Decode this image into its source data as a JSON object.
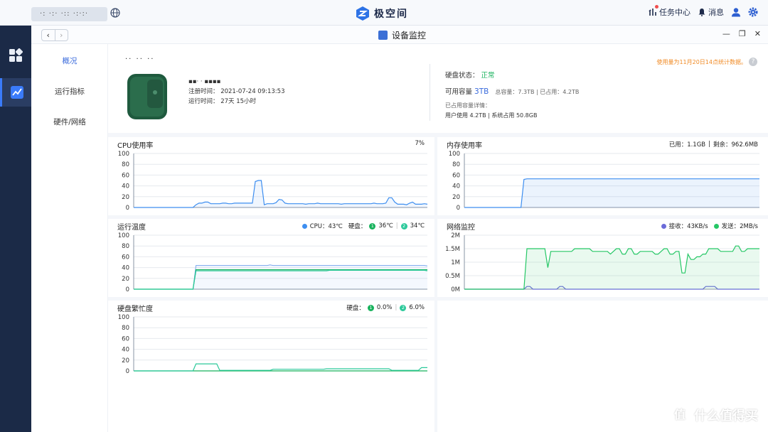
{
  "topbar": {
    "device_label": "·: ·:· ·:: ·:·:·",
    "brand": "极空间",
    "task_center": "任务中心",
    "messages": "消息"
  },
  "window": {
    "title": "设备监控",
    "nav_back": "‹",
    "nav_forward": "›"
  },
  "sidenav": {
    "items": [
      {
        "label": "概况"
      },
      {
        "label": "运行指标"
      },
      {
        "label": "硬件/网络"
      }
    ],
    "active_index": 0
  },
  "device": {
    "name": "·· ·· ··",
    "model_line": "▪▪·    ·    ▪▪▪▪",
    "reg_time": "注册时间： 2021-07-24 09:13:53",
    "uptime": "运行时间： 27天 15小时"
  },
  "storage": {
    "status_label": "硬盘状态：",
    "status_value": "正常",
    "available_label": "可用容量",
    "available_value": "3TB",
    "total": "总容量：7.3TB",
    "used": "已占用：4.2TB",
    "detail_label": "已占用容量详情：",
    "user_used": "用户使用 4.2TB",
    "system_used": "系统占用 50.8GB"
  },
  "notice": "使用量为11月20日14点统计数据。",
  "help_icon": "?",
  "charts": {
    "cpu": {
      "title": "CPU使用率",
      "value": "7%"
    },
    "memory": {
      "title": "内存使用率",
      "used": "已用：1.1GB",
      "remaining": "剩余：962.6MB"
    },
    "temperature": {
      "title": "运行温度",
      "cpu": "CPU：43℃",
      "disk_label": "硬盘：",
      "disk1_num": "1",
      "disk1": "36℃",
      "disk2_num": "2",
      "disk2": "34℃"
    },
    "network": {
      "title": "网络监控",
      "rx": "接收：43KB/s",
      "tx": "发送：2MB/s"
    },
    "disk_busy": {
      "title": "硬盘繁忙度",
      "disk_label": "硬盘：",
      "disk1_num": "1",
      "disk1": "0.0%",
      "disk2_num": "2",
      "disk2": "6.0%"
    }
  },
  "watermark": {
    "text": "什么值得买",
    "logo": "值"
  },
  "colors": {
    "accent": "#3a6bdc",
    "cpu": "#3d8ef0",
    "green": "#17b25c",
    "rx": "#6b6bd9",
    "tx": "#26c766",
    "orange": "#f08a24"
  },
  "chart_data": [
    {
      "type": "line",
      "title": "CPU使用率",
      "ylim": [
        0,
        100
      ],
      "yticks": [
        "100",
        "80",
        "60",
        "40",
        "20",
        "0"
      ],
      "series": [
        {
          "values": [
            0,
            0,
            0,
            0,
            0,
            0,
            0,
            0,
            0,
            0,
            0,
            0,
            0,
            0,
            0,
            0,
            0,
            0,
            0,
            0,
            0,
            5,
            8,
            8,
            10,
            10,
            7,
            7,
            7,
            7,
            8,
            8,
            7,
            7,
            8,
            8,
            8,
            8,
            8,
            8,
            8,
            48,
            50,
            50,
            5,
            7,
            7,
            7,
            9,
            15,
            14,
            8,
            7,
            7,
            7,
            7,
            7,
            7,
            6,
            7,
            7,
            7,
            8,
            7,
            7,
            7,
            7,
            7,
            7,
            7,
            6,
            7,
            7,
            7,
            7,
            7,
            7,
            7,
            7,
            7,
            7,
            8,
            7,
            7,
            7,
            8,
            18,
            18,
            10,
            6,
            6,
            6,
            5,
            8,
            10,
            6,
            6,
            6,
            7,
            6
          ]
        }
      ]
    },
    {
      "type": "area",
      "title": "内存使用率",
      "ylim": [
        0,
        100
      ],
      "yticks": [
        "100",
        "80",
        "60",
        "40",
        "20",
        "0"
      ],
      "series": [
        {
          "values": [
            0,
            0,
            0,
            0,
            0,
            0,
            0,
            0,
            0,
            0,
            0,
            0,
            0,
            0,
            0,
            0,
            0,
            0,
            0,
            0,
            52,
            53,
            53,
            53,
            53,
            53,
            53,
            53,
            53,
            53,
            53,
            53,
            53,
            53,
            53,
            53,
            53,
            53,
            53,
            53,
            53,
            53,
            53,
            53,
            53,
            53,
            53,
            53,
            53,
            53,
            53,
            53,
            53,
            53,
            53,
            53,
            53,
            53,
            53,
            53,
            53,
            53,
            53,
            53,
            53,
            53,
            53,
            53,
            53,
            53,
            53,
            53,
            53,
            53,
            53,
            53,
            53,
            53,
            53,
            53,
            53,
            53,
            53,
            53,
            53,
            53,
            53,
            53,
            53,
            53,
            53,
            53,
            53,
            53,
            53,
            53,
            53,
            53,
            53,
            53
          ]
        }
      ]
    },
    {
      "type": "line",
      "title": "运行温度",
      "ylim": [
        0,
        100
      ],
      "yticks": [
        "100",
        "80",
        "60",
        "40",
        "20",
        "0"
      ],
      "series": [
        {
          "name": "CPU",
          "values": [
            0,
            0,
            0,
            0,
            0,
            0,
            0,
            0,
            0,
            0,
            0,
            0,
            0,
            0,
            0,
            0,
            0,
            0,
            0,
            0,
            0,
            44,
            44,
            44,
            44,
            44,
            44,
            44,
            44,
            44,
            44,
            44,
            44,
            44,
            44,
            44,
            44,
            44,
            44,
            44,
            44,
            44,
            44,
            44,
            44,
            44,
            45,
            44,
            44,
            44,
            44,
            44,
            44,
            44,
            44,
            44,
            44,
            44,
            44,
            44,
            44,
            44,
            44,
            44,
            44,
            44,
            44,
            44,
            44,
            44,
            44,
            44,
            44,
            44,
            44,
            44,
            44,
            44,
            44,
            44,
            44,
            44,
            44,
            44,
            44,
            44,
            44,
            44,
            44,
            44,
            44,
            44,
            44,
            44,
            44,
            44,
            44,
            44,
            44,
            43
          ]
        },
        {
          "name": "1",
          "values": [
            0,
            0,
            0,
            0,
            0,
            0,
            0,
            0,
            0,
            0,
            0,
            0,
            0,
            0,
            0,
            0,
            0,
            0,
            0,
            0,
            0,
            36,
            36,
            36,
            36,
            36,
            36,
            36,
            36,
            36,
            36,
            36,
            36,
            36,
            36,
            36,
            36,
            36,
            36,
            36,
            36,
            36,
            36,
            36,
            36,
            36,
            36,
            36,
            36,
            36,
            36,
            36,
            36,
            36,
            36,
            36,
            36,
            36,
            36,
            36,
            36,
            36,
            36,
            36,
            36,
            36,
            36,
            36,
            36,
            36,
            36,
            36,
            36,
            36,
            36,
            36,
            36,
            36,
            36,
            36,
            36,
            36,
            36,
            36,
            36,
            36,
            36,
            36,
            36,
            36,
            36,
            36,
            36,
            36,
            36,
            36,
            36,
            36,
            36,
            36
          ]
        },
        {
          "name": "2",
          "values": [
            0,
            0,
            0,
            0,
            0,
            0,
            0,
            0,
            0,
            0,
            0,
            0,
            0,
            0,
            0,
            0,
            0,
            0,
            0,
            0,
            0,
            34,
            34,
            34,
            34,
            34,
            34,
            34,
            34,
            34,
            34,
            34,
            34,
            34,
            34,
            34,
            34,
            34,
            34,
            34,
            34,
            34,
            34,
            34,
            34,
            34,
            34,
            34,
            34,
            34,
            34,
            34,
            34,
            34,
            34,
            34,
            34,
            34,
            34,
            34,
            34,
            34,
            34,
            34,
            34,
            34,
            35,
            35,
            35,
            35,
            35,
            35,
            35,
            35,
            35,
            35,
            35,
            35,
            35,
            35,
            35,
            35,
            35,
            35,
            35,
            35,
            35,
            35,
            35,
            35,
            35,
            35,
            35,
            35,
            35,
            35,
            35,
            35,
            35,
            34
          ]
        }
      ]
    },
    {
      "type": "area",
      "title": "网络监控",
      "ylim": [
        0,
        2
      ],
      "yticks": [
        "2M",
        "1.5M",
        "1M",
        "0.5M",
        "0M"
      ],
      "series": [
        {
          "name": "接收",
          "values": [
            0,
            0,
            0,
            0,
            0,
            0,
            0,
            0,
            0,
            0,
            0,
            0,
            0,
            0,
            0,
            0,
            0,
            0,
            0,
            0,
            0,
            0.1,
            0.1,
            0,
            0,
            0,
            0,
            0,
            0,
            0,
            0,
            0,
            0.1,
            0.1,
            0,
            0,
            0,
            0,
            0,
            0,
            0,
            0,
            0,
            0,
            0,
            0,
            0,
            0,
            0,
            0,
            0,
            0,
            0,
            0,
            0,
            0,
            0,
            0,
            0,
            0,
            0,
            0,
            0,
            0,
            0,
            0,
            0,
            0,
            0,
            0,
            0,
            0,
            0,
            0,
            0,
            0,
            0,
            0,
            0,
            0,
            0,
            0.1,
            0.1,
            0.1,
            0.1,
            0,
            0,
            0,
            0,
            0,
            0,
            0,
            0,
            0,
            0,
            0,
            0,
            0,
            0,
            0
          ]
        },
        {
          "name": "发送",
          "values": [
            0,
            0,
            0,
            0,
            0,
            0,
            0,
            0,
            0,
            0,
            0,
            0,
            0,
            0,
            0,
            0,
            0,
            0,
            0,
            0,
            0,
            1.5,
            1.5,
            1.5,
            1.5,
            1.5,
            1.5,
            1.5,
            0.8,
            1.4,
            1.4,
            1.4,
            1.4,
            1.4,
            1.4,
            1.4,
            1.4,
            1.5,
            1.5,
            1.5,
            1.5,
            1.5,
            1.5,
            1.4,
            1.4,
            1.4,
            1.4,
            1.4,
            1.4,
            1.3,
            1.4,
            1.5,
            1.5,
            1.3,
            1.3,
            1.5,
            1.5,
            1.3,
            1.3,
            1.4,
            1.4,
            1.4,
            1.4,
            1.4,
            1.3,
            1.3,
            1.4,
            1.5,
            1.5,
            1.3,
            1.3,
            1.4,
            1.4,
            0.6,
            0.6,
            1.3,
            1.1,
            1.1,
            1.2,
            1.2,
            1.3,
            1.3,
            1.5,
            1.5,
            1.5,
            1.5,
            1.4,
            1.4,
            1.4,
            1.4,
            1.4,
            1.6,
            1.6,
            1.4,
            1.4,
            1.5,
            1.5,
            1.5,
            1.5,
            1.5
          ]
        }
      ]
    },
    {
      "type": "line",
      "title": "硬盘繁忙度",
      "ylim": [
        0,
        100
      ],
      "yticks": [
        "100",
        "80",
        "60",
        "40",
        "20",
        "0"
      ],
      "series": [
        {
          "name": "1",
          "values": [
            0,
            0,
            0,
            0,
            0,
            0,
            0,
            0,
            0,
            0,
            0,
            0,
            0,
            0,
            0,
            0,
            0,
            0,
            0,
            0,
            0,
            0,
            0,
            0,
            0,
            0,
            0,
            0,
            0,
            0,
            0,
            0,
            0,
            0,
            0,
            0,
            0,
            0,
            0,
            0,
            0,
            0,
            0,
            0,
            0,
            0,
            0,
            0,
            0,
            0,
            0,
            0,
            0,
            0,
            0,
            0,
            0,
            0,
            0,
            0,
            0,
            0,
            0,
            0,
            0,
            0,
            0,
            0,
            0,
            0,
            0,
            0,
            0,
            0,
            0,
            0,
            0,
            0,
            0,
            0,
            0,
            0,
            0,
            0,
            0,
            0,
            0,
            0,
            0,
            0,
            0,
            0,
            0,
            0,
            0,
            0,
            0,
            0,
            0,
            0
          ]
        },
        {
          "name": "2",
          "values": [
            0,
            0,
            0,
            0,
            0,
            0,
            0,
            0,
            0,
            0,
            0,
            0,
            0,
            0,
            0,
            0,
            0,
            0,
            0,
            0,
            0,
            13,
            13,
            13,
            13,
            13,
            13,
            13,
            13,
            1,
            1,
            1,
            1,
            1,
            1,
            1,
            1,
            1,
            1,
            1,
            1,
            1,
            1,
            1,
            1,
            1,
            1,
            3,
            3,
            3,
            3,
            3,
            3,
            3,
            3,
            3,
            3,
            3,
            3,
            3,
            3,
            3,
            3,
            3,
            3,
            4,
            4,
            4,
            4,
            4,
            4,
            4,
            4,
            4,
            4,
            4,
            4,
            4,
            4,
            4,
            4,
            4,
            4,
            4,
            4,
            4,
            4,
            1,
            1,
            1,
            1,
            1,
            1,
            1,
            1,
            1,
            1,
            6,
            6,
            6
          ]
        }
      ]
    }
  ]
}
